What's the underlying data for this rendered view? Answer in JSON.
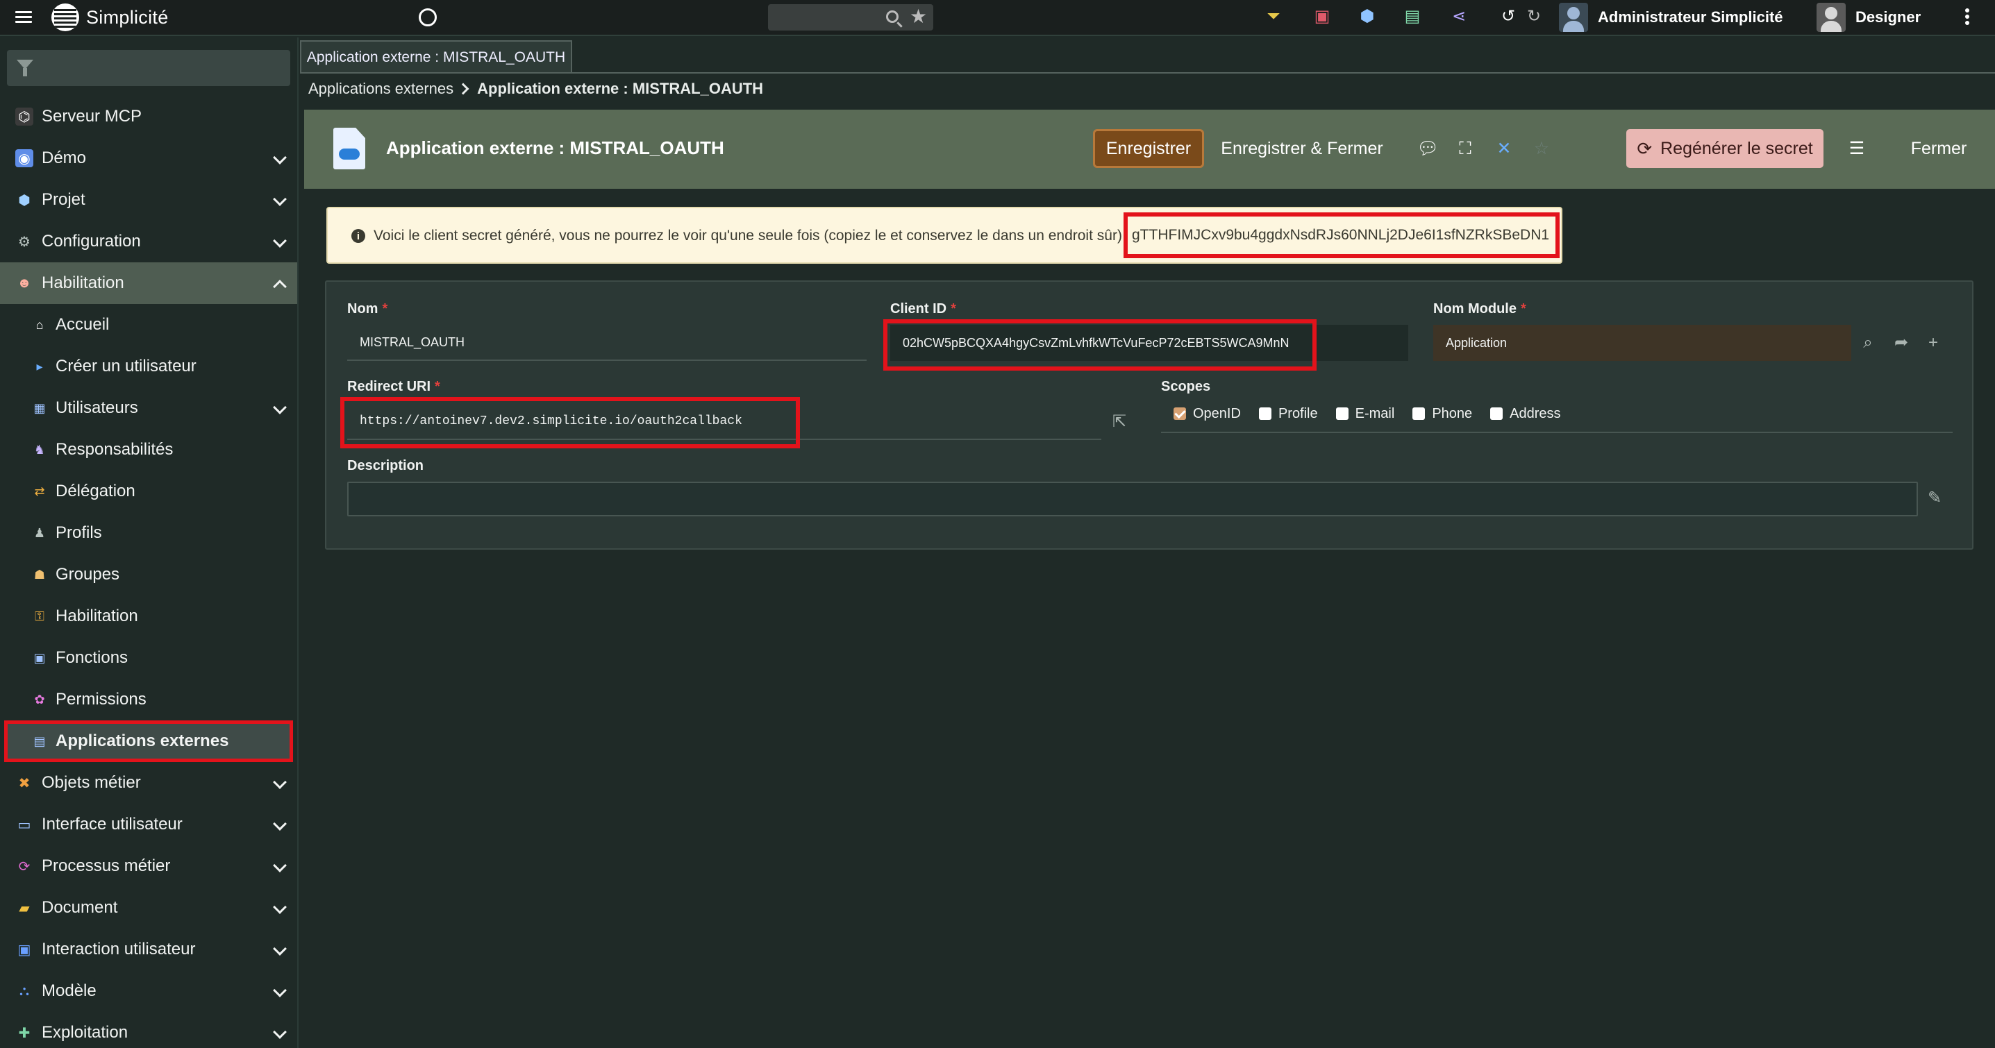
{
  "topbar": {
    "brand": "Simplicité",
    "user1": "Administrateur Simplicité",
    "user2": "Designer"
  },
  "sidebar": {
    "items": [
      {
        "label": "Serveur MCP",
        "icon": "mcp-icon"
      },
      {
        "label": "Démo",
        "icon": "demo-icon"
      },
      {
        "label": "Projet",
        "icon": "project-icon"
      },
      {
        "label": "Configuration",
        "icon": "gear-icon"
      },
      {
        "label": "Habilitation",
        "icon": "habilitation-icon"
      },
      {
        "label": "Accueil",
        "icon": "home-icon"
      },
      {
        "label": "Créer un utilisateur",
        "icon": "play-icon"
      },
      {
        "label": "Utilisateurs",
        "icon": "users-icon"
      },
      {
        "label": "Responsabilités",
        "icon": "responsibility-icon"
      },
      {
        "label": "Délégation",
        "icon": "delegation-icon"
      },
      {
        "label": "Profils",
        "icon": "profiles-icon"
      },
      {
        "label": "Groupes",
        "icon": "groups-icon"
      },
      {
        "label": "Habilitation",
        "icon": "key-icon"
      },
      {
        "label": "Fonctions",
        "icon": "functions-icon"
      },
      {
        "label": "Permissions",
        "icon": "permissions-icon"
      },
      {
        "label": "Applications externes",
        "icon": "external-app-icon"
      },
      {
        "label": "Objets métier",
        "icon": "business-objects-icon"
      },
      {
        "label": "Interface utilisateur",
        "icon": "ui-icon"
      },
      {
        "label": "Processus métier",
        "icon": "process-icon"
      },
      {
        "label": "Document",
        "icon": "folder-icon"
      },
      {
        "label": "Interaction utilisateur",
        "icon": "interaction-icon"
      },
      {
        "label": "Modèle",
        "icon": "model-icon"
      },
      {
        "label": "Exploitation",
        "icon": "operations-icon"
      }
    ]
  },
  "tab": {
    "label": "Application externe : MISTRAL_OAUTH"
  },
  "breadcrumb": {
    "parent": "Applications externes",
    "current": "Application externe : MISTRAL_OAUTH"
  },
  "header": {
    "title": "Application externe : MISTRAL_OAUTH",
    "save": "Enregistrer",
    "save_close": "Enregistrer & Fermer",
    "regenerate": "Regénérer le secret",
    "close": "Fermer"
  },
  "alert": {
    "message": "Voici le client secret généré, vous ne pourrez le voir qu'une seule fois (copiez le et conservez le dans un endroit sûr)",
    "secret": "gTTHFIMJCxv9bu4ggdxNsdRJs60NNLj2DJe6I1sfNZRkSBeDN1"
  },
  "form": {
    "nom_label": "Nom",
    "nom_value": "MISTRAL_OAUTH",
    "client_id_label": "Client ID",
    "client_id_value": "02hCW5pBCQXA4hgyCsvZmLvhfkWTcVuFecP72cEBTS5WCA9MnN",
    "module_label": "Nom Module",
    "module_value": "Application",
    "redirect_label": "Redirect URI",
    "redirect_value": "https://antoinev7.dev2.simplicite.io/oauth2callback",
    "scopes_label": "Scopes",
    "scopes": [
      "OpenID",
      "Profile",
      "E-mail",
      "Phone",
      "Address"
    ],
    "description_label": "Description"
  },
  "colors": {
    "accent_red": "#e3131b",
    "header_bg": "#5a6b56",
    "primary_button": "#7a4a1a"
  }
}
